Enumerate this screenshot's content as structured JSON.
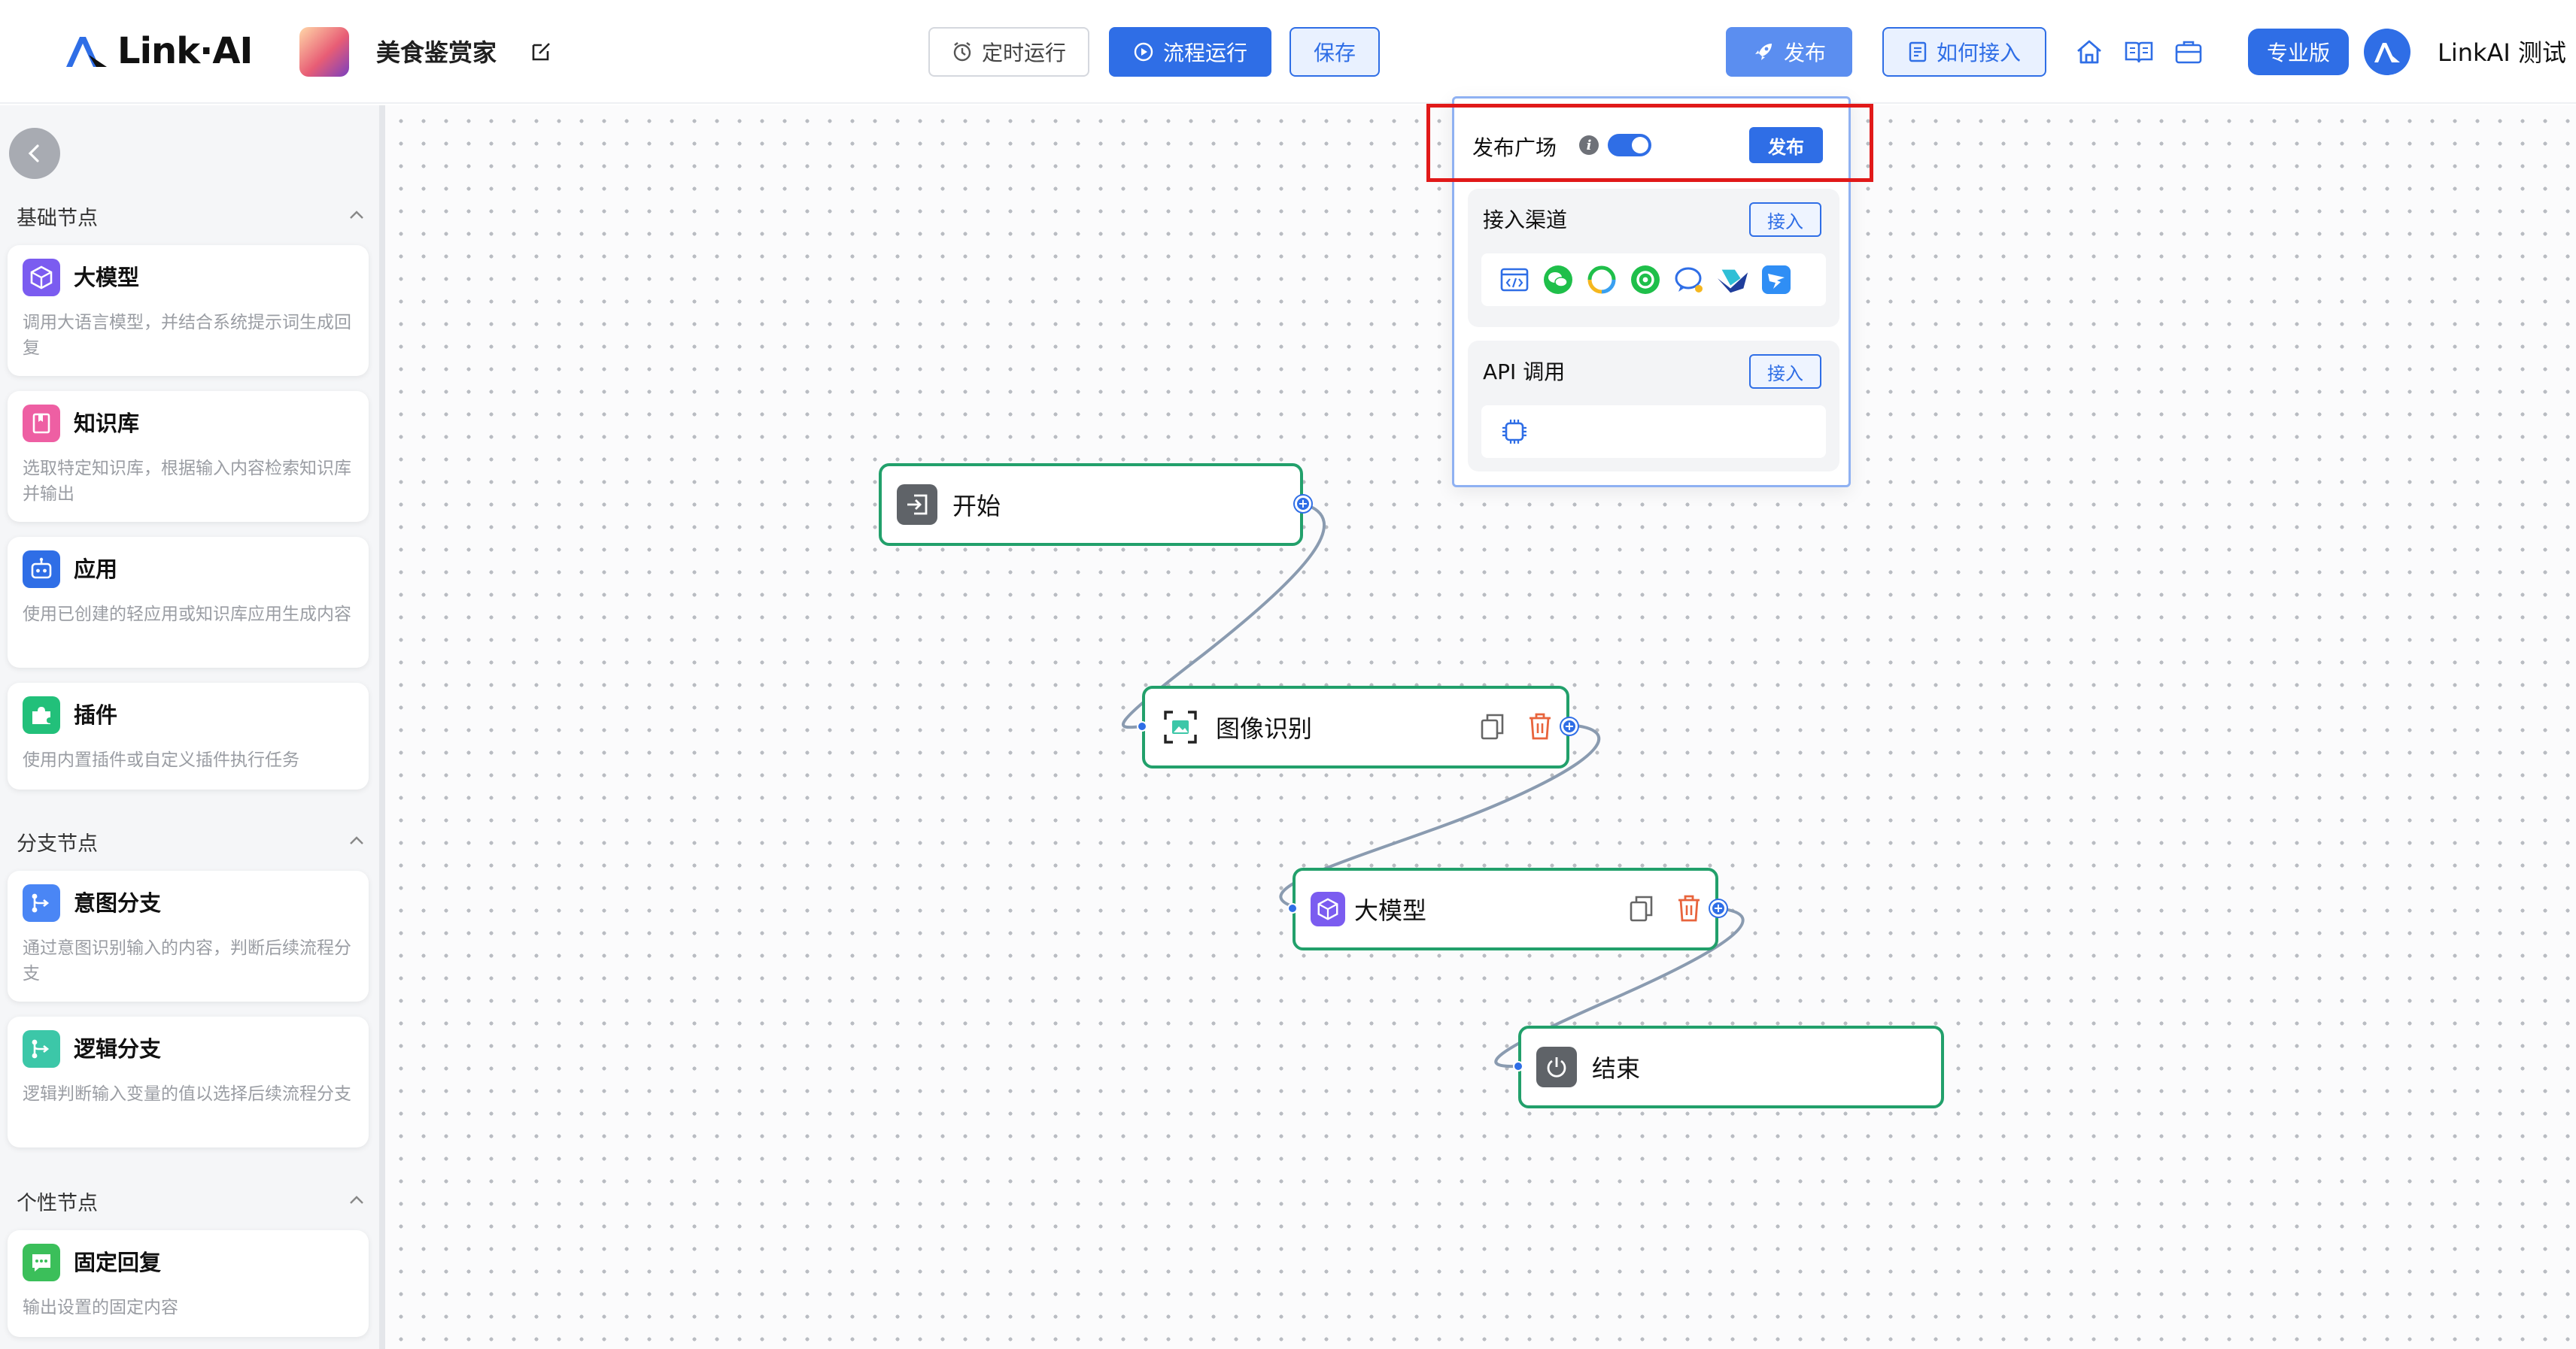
{
  "header": {
    "logo_text": "Link·AI",
    "app_name": "美食鉴赏家",
    "schedule_label": "定时运行",
    "run_label": "流程运行",
    "save_label": "保存",
    "publish_label": "发布",
    "howto_label": "如何接入",
    "pro_label": "专业版",
    "user_name": "LinkAI 测试"
  },
  "sidebar": {
    "sections": [
      {
        "title": "基础节点"
      },
      {
        "title": "分支节点"
      },
      {
        "title": "个性节点"
      }
    ],
    "cards": [
      {
        "title": "大模型",
        "desc": "调用大语言模型，并结合系统提示词生成回复",
        "icon": "llm-cube-icon",
        "color": "#7b5cf0"
      },
      {
        "title": "知识库",
        "desc": "选取特定知识库，根据输入内容检索知识库并输出",
        "icon": "knowledge-book-icon",
        "color": "#ee5fa3"
      },
      {
        "title": "应用",
        "desc": "使用已创建的轻应用或知识库应用生成内容",
        "icon": "robot-icon",
        "color": "#2f6ee6"
      },
      {
        "title": "插件",
        "desc": "使用内置插件或自定义插件执行任务",
        "icon": "puzzle-icon",
        "color": "#22c07a"
      },
      {
        "title": "意图分支",
        "desc": "通过意图识别输入的内容，判断后续流程分支",
        "icon": "branch-icon",
        "color": "#4a86f5"
      },
      {
        "title": "逻辑分支",
        "desc": "逻辑判断输入变量的值以选择后续流程分支",
        "icon": "logic-branch-icon",
        "color": "#3cc7a8"
      },
      {
        "title": "固定回复",
        "desc": "输出设置的固定内容",
        "icon": "message-icon",
        "color": "#3bbf5a"
      }
    ]
  },
  "canvas": {
    "nodes": [
      {
        "label": "开始",
        "icon": "enter-icon"
      },
      {
        "label": "图像识别",
        "icon": "image-scan-icon"
      },
      {
        "label": "大模型",
        "icon": "llm-cube-icon"
      },
      {
        "label": "结束",
        "icon": "power-icon"
      }
    ]
  },
  "popover": {
    "plaza_label": "发布广场",
    "plaza_enabled": true,
    "plaza_button": "发布",
    "channels_label": "接入渠道",
    "channels_button": "接入",
    "channels": [
      "web-embed-icon",
      "wechat-icon",
      "wechat-work-icon",
      "wechat-mp-icon",
      "chat-bubble-icon",
      "feishu-icon",
      "dingtalk-icon"
    ],
    "api_label": "API 调用",
    "api_button": "接入",
    "api_icon": "api-chip-icon"
  },
  "colors": {
    "primary": "#2f6ee6",
    "node_border": "#22a06b",
    "highlight": "#e11919"
  }
}
